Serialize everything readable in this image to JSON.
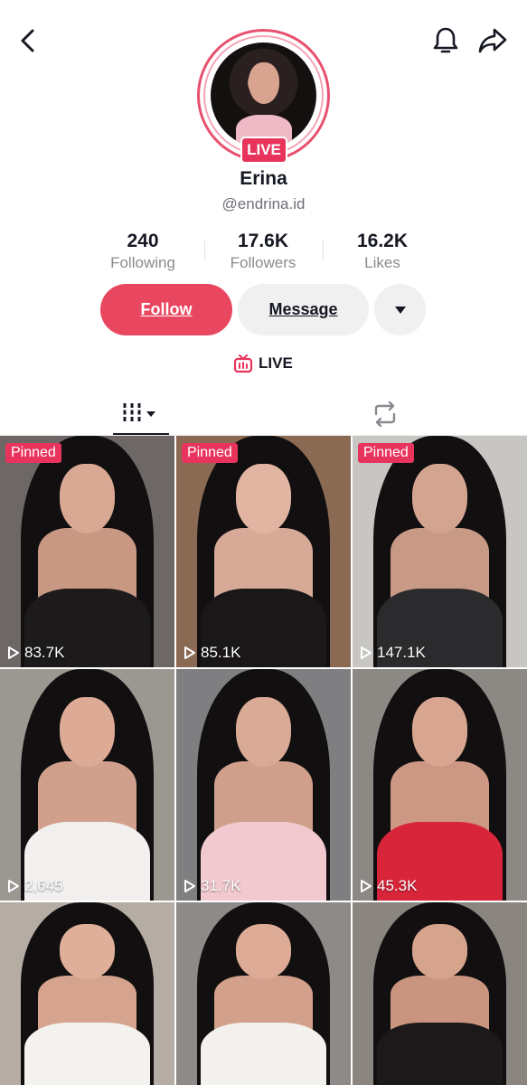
{
  "header": {
    "back_icon": "chevron-left-icon",
    "bell_icon": "bell-icon",
    "share_icon": "share-arrow-icon"
  },
  "profile": {
    "live_badge": "LIVE",
    "name": "Erina",
    "handle": "@endrina.id"
  },
  "stats": [
    {
      "value": "240",
      "label": "Following"
    },
    {
      "value": "17.6K",
      "label": "Followers"
    },
    {
      "value": "16.2K",
      "label": "Likes"
    }
  ],
  "actions": {
    "follow_label": "Follow",
    "message_label": "Message",
    "more_icon": "caret-down-icon"
  },
  "live_link": {
    "label": "LIVE",
    "icon": "tv-live-icon"
  },
  "tabs": {
    "videos_icon": "grid-bars-icon",
    "reposts_icon": "repost-icon"
  },
  "videos": [
    {
      "pinned": "Pinned",
      "views": "83.7K"
    },
    {
      "pinned": "Pinned",
      "views": "85.1K"
    },
    {
      "pinned": "Pinned",
      "views": "147.1K"
    },
    {
      "pinned": null,
      "views": "2,645"
    },
    {
      "pinned": null,
      "views": "31.7K"
    },
    {
      "pinned": null,
      "views": "45.3K"
    },
    {
      "pinned": null,
      "views": null
    },
    {
      "pinned": null,
      "views": null
    },
    {
      "pinned": null,
      "views": null
    }
  ],
  "colors": {
    "accent": "#e8475f",
    "live_badge": "#e8345c",
    "text_primary": "#161823",
    "text_secondary": "#8a8b91"
  }
}
